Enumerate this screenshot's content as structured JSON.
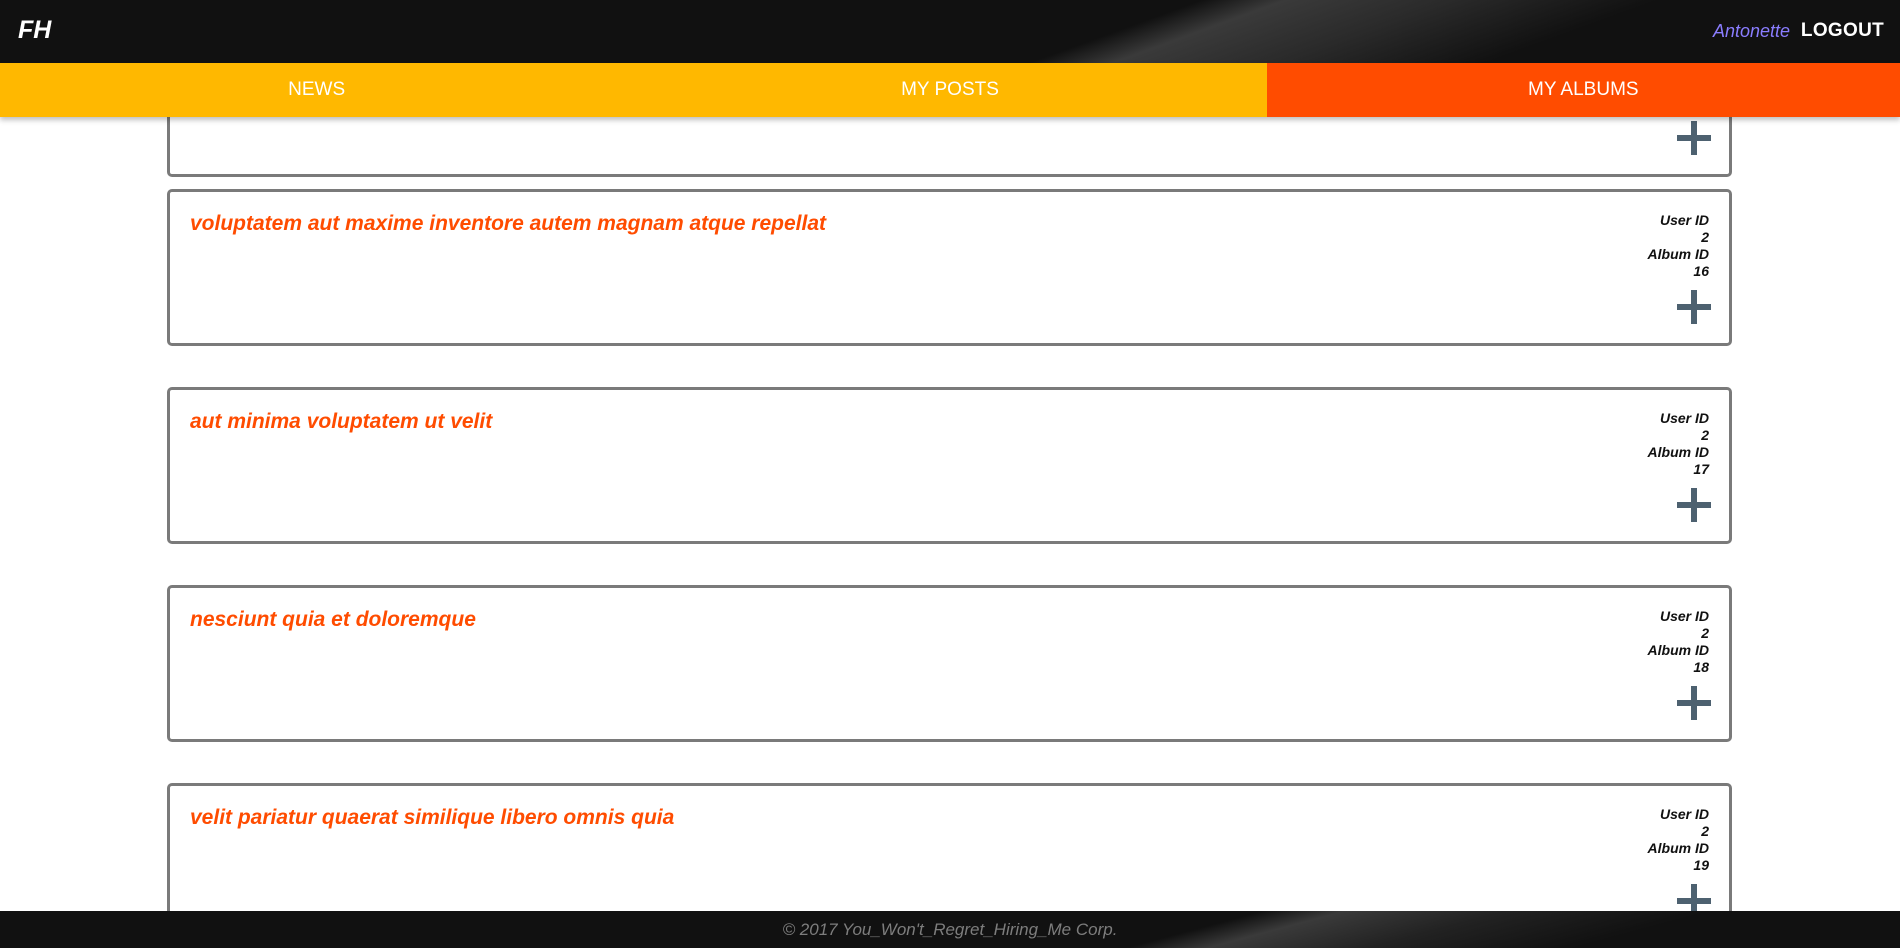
{
  "header": {
    "logo": "FH",
    "username": "Antonette",
    "logout_label": "LOGOUT"
  },
  "nav": {
    "tabs": [
      {
        "label": "NEWS",
        "active": false
      },
      {
        "label": "MY POSTS",
        "active": false
      },
      {
        "label": "MY ALBUMS",
        "active": true
      }
    ]
  },
  "albums": [
    {
      "title": "voluptatem aut maxime inventore autem magnam atque repellat",
      "user_id_label": "User ID",
      "user_id": "2",
      "album_id_label": "Album ID",
      "album_id": "16"
    },
    {
      "title": "aut minima voluptatem ut velit",
      "user_id_label": "User ID",
      "user_id": "2",
      "album_id_label": "Album ID",
      "album_id": "17"
    },
    {
      "title": "nesciunt quia et doloremque",
      "user_id_label": "User ID",
      "user_id": "2",
      "album_id_label": "Album ID",
      "album_id": "18"
    },
    {
      "title": "velit pariatur quaerat similique libero omnis quia",
      "user_id_label": "User ID",
      "user_id": "2",
      "album_id_label": "Album ID",
      "album_id": "19"
    }
  ],
  "footer": {
    "copyright": "© 2017 You_Won't_Regret_Hiring_Me Corp."
  },
  "colors": {
    "accent": "#ff4c00",
    "nav_bg": "#ffb800",
    "header_bg": "#111111",
    "username": "#8a7dff",
    "plus_icon": "#4d6170"
  }
}
